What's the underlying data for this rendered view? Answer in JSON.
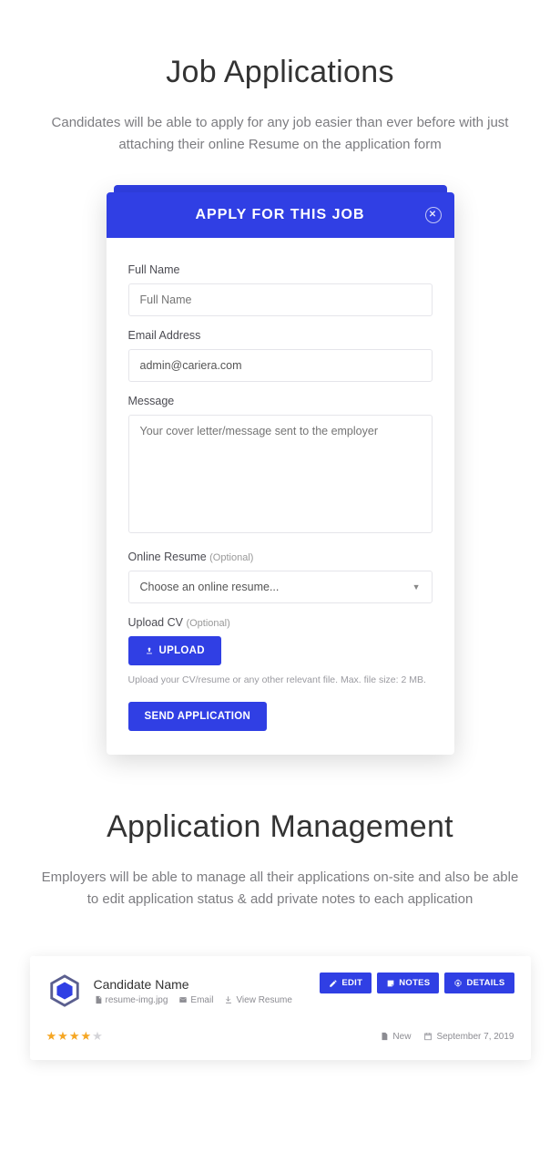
{
  "section1": {
    "title": "Job Applications",
    "subtitle": "Candidates will be able to apply for any job easier than ever before with just attaching their online Resume on the application form"
  },
  "modal": {
    "header": "APPLY FOR THIS JOB",
    "fullname_label": "Full Name",
    "fullname_placeholder": "Full Name",
    "email_label": "Email Address",
    "email_value": "admin@cariera.com",
    "message_label": "Message",
    "message_placeholder": "Your cover letter/message sent to the employer",
    "resume_label": "Online Resume",
    "optional": "(Optional)",
    "resume_select": "Choose an online resume...",
    "upload_label": "Upload CV",
    "upload_btn": "UPLOAD",
    "upload_hint": "Upload your CV/resume or any other relevant file. Max. file size: 2 MB.",
    "send_btn": "SEND APPLICATION"
  },
  "section2": {
    "title": "Application Management",
    "subtitle": "Employers will be able to manage all their applications on-site and also be able to edit application status & add private notes to each application"
  },
  "app": {
    "candidate": "Candidate Name",
    "resume_file": "resume-img.jpg",
    "email_link": "Email",
    "view_resume": "View Resume",
    "edit": "EDIT",
    "notes": "NOTES",
    "details": "DETAILS",
    "status": "New",
    "date": "September 7, 2019"
  }
}
